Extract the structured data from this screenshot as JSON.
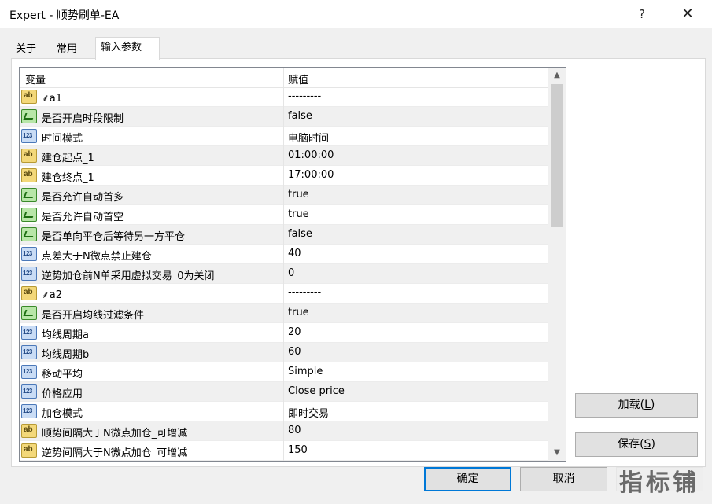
{
  "window": {
    "title": "Expert - 顺势刷单-EA",
    "help_glyph": "?",
    "close_glyph": "✕"
  },
  "tabs": [
    "关于",
    "常用",
    "输入参数"
  ],
  "table": {
    "col_variable": "变量",
    "col_value": "赋值",
    "rows": [
      {
        "type": "ab",
        "name": "⸙a1",
        "value": "---------"
      },
      {
        "type": "bool",
        "name": "是否开启时段限制",
        "value": "false"
      },
      {
        "type": "num",
        "name": "时间模式",
        "value": "电脑时间"
      },
      {
        "type": "ab",
        "name": "建仓起点_1",
        "value": "01:00:00"
      },
      {
        "type": "ab",
        "name": "建仓终点_1",
        "value": "17:00:00"
      },
      {
        "type": "bool",
        "name": "是否允许自动首多",
        "value": "true"
      },
      {
        "type": "bool",
        "name": "是否允许自动首空",
        "value": "true"
      },
      {
        "type": "bool",
        "name": "是否单向平仓后等待另一方平仓",
        "value": "false"
      },
      {
        "type": "num",
        "name": "点差大于N微点禁止建仓",
        "value": "40"
      },
      {
        "type": "num",
        "name": "逆势加仓前N单采用虚拟交易_0为关闭",
        "value": "0"
      },
      {
        "type": "ab",
        "name": "⸙a2",
        "value": "---------"
      },
      {
        "type": "bool",
        "name": "是否开启均线过滤条件",
        "value": "true"
      },
      {
        "type": "num",
        "name": "均线周期a",
        "value": "20"
      },
      {
        "type": "num",
        "name": "均线周期b",
        "value": "60"
      },
      {
        "type": "num",
        "name": "移动平均",
        "value": "Simple"
      },
      {
        "type": "num",
        "name": "价格应用",
        "value": "Close price"
      },
      {
        "type": "num",
        "name": "加仓模式",
        "value": "即时交易"
      },
      {
        "type": "ab",
        "name": "顺势间隔大于N微点加仓_可增减",
        "value": "80"
      },
      {
        "type": "ab",
        "name": "逆势间隔大于N微点加仓_可增减",
        "value": "150"
      }
    ]
  },
  "buttons": {
    "load": "加载(",
    "load_key": "L",
    "load_end": ")",
    "save": "保存(",
    "save_key": "S",
    "save_end": ")",
    "ok": "确定",
    "cancel": "取消"
  },
  "watermark": "指标铺"
}
